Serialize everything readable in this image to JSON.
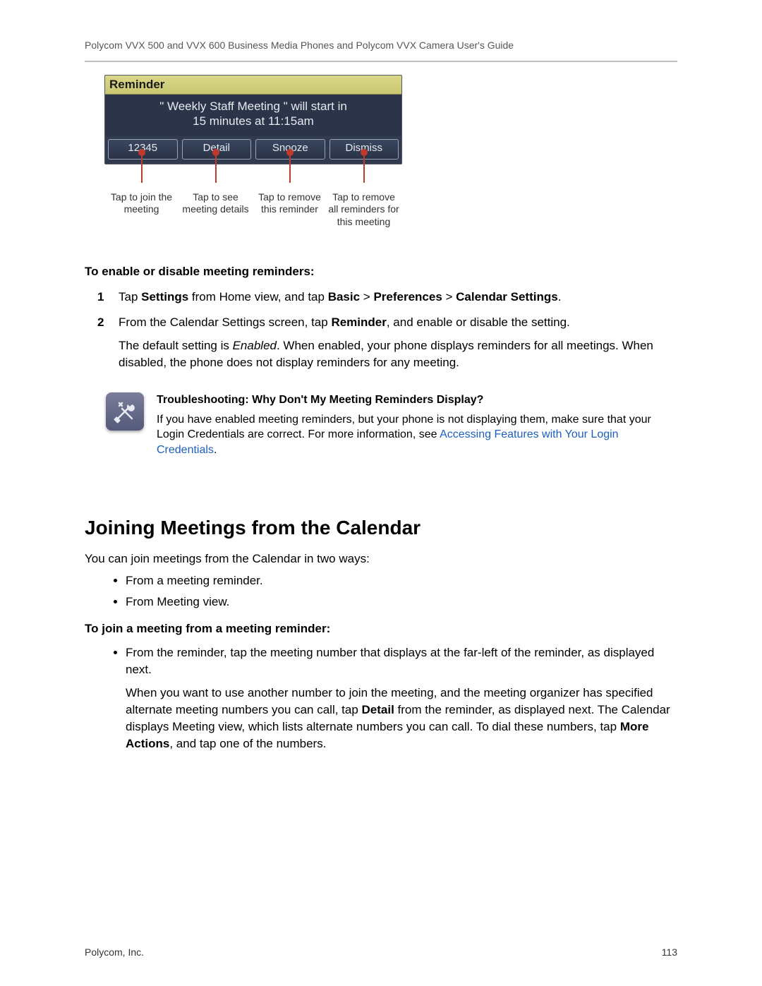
{
  "header": {
    "running_title": "Polycom VVX 500 and VVX 600 Business Media Phones and Polycom VVX Camera User's Guide"
  },
  "phone": {
    "title": "Reminder",
    "body": "\" Weekly Staff Meeting \" will start in\n15 minutes at 11:15am",
    "softkeys": [
      "12345",
      "Detail",
      "Snooze",
      "Dismiss"
    ],
    "callouts": [
      "Tap to join the meeting",
      "Tap to see meeting details",
      "Tap to remove this reminder",
      "Tap to remove all reminders for this meeting"
    ]
  },
  "section_enable": {
    "title": "To enable or disable meeting reminders:",
    "steps": [
      {
        "num": "1",
        "parts": [
          {
            "t": "Tap "
          },
          {
            "t": "Settings",
            "b": true
          },
          {
            "t": " from Home view, and tap "
          },
          {
            "t": "Basic",
            "b": true
          },
          {
            "t": " > "
          },
          {
            "t": "Preferences",
            "b": true
          },
          {
            "t": " > "
          },
          {
            "t": "Calendar Settings",
            "b": true
          },
          {
            "t": "."
          }
        ]
      },
      {
        "num": "2",
        "parts": [
          {
            "t": "From the Calendar Settings screen, tap "
          },
          {
            "t": "Reminder",
            "b": true
          },
          {
            "t": ", and enable or disable the setting."
          }
        ],
        "extra": [
          {
            "t": "The default setting is "
          },
          {
            "t": "Enabled",
            "i": true
          },
          {
            "t": ". When enabled, your phone displays reminders for all meetings. When disabled, the phone does not display reminders for any meeting."
          }
        ]
      }
    ]
  },
  "troubleshoot": {
    "title": "Troubleshooting: Why Don't My Meeting Reminders Display?",
    "body_pre": "If you have enabled meeting reminders, but your phone is not displaying them, make sure that your Login Credentials are correct. For more information, see ",
    "link": "Accessing Features with Your Login Credentials",
    "body_post": "."
  },
  "joining": {
    "heading": "Joining Meetings from the Calendar",
    "intro": "You can join meetings from the Calendar in two ways:",
    "bullets": [
      "From a meeting reminder.",
      "From Meeting view."
    ],
    "subhead": "To join a meeting from a meeting reminder:",
    "sub_bullets": [
      [
        {
          "t": "From the reminder, tap the meeting number that displays at the far-left of the reminder, as displayed next."
        }
      ]
    ],
    "extra_para": [
      {
        "t": "When you want to use another number to join the meeting, and the meeting organizer has specified alternate meeting numbers you can call, tap "
      },
      {
        "t": "Detail",
        "b": true
      },
      {
        "t": " from the reminder, as displayed next. The Calendar displays Meeting view, which lists alternate numbers you can call. To dial these numbers, tap "
      },
      {
        "t": "More Actions",
        "b": true
      },
      {
        "t": ", and tap one of the numbers."
      }
    ]
  },
  "footer": {
    "left": "Polycom, Inc.",
    "right": "113"
  }
}
